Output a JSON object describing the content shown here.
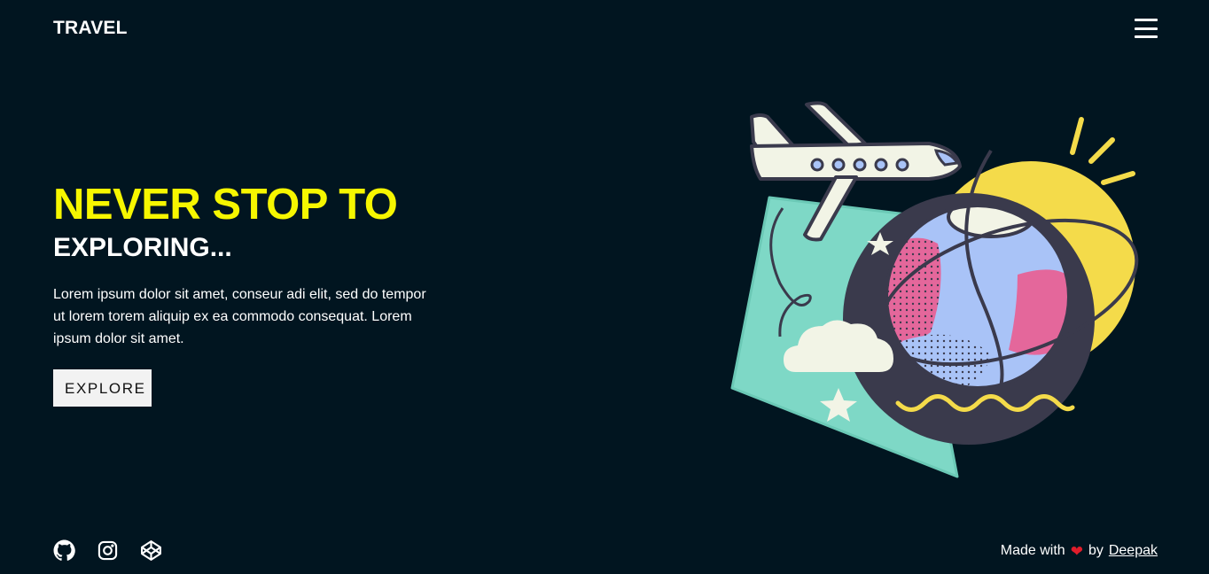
{
  "header": {
    "logo": "TRAVEL",
    "menu_icon": "hamburger-menu-icon"
  },
  "hero": {
    "title": "NEVER STOP TO",
    "subtitle": "EXPLORING...",
    "text": "Lorem ipsum dolor sit amet, conseur adi elit, sed do tempor ut lorem torem aliquip ex ea commodo consequat. Lorem ipsum dolor sit amet.",
    "button_label": "EXPLORE"
  },
  "illustration": {
    "icon": "travel-airplane-globe-illustration"
  },
  "footer": {
    "social": [
      "github-icon",
      "instagram-icon",
      "codepen-icon"
    ],
    "credit_prefix": "Made with",
    "credit_heart": "❤",
    "credit_mid": "by",
    "author": "Deepak"
  },
  "colors": {
    "background": "#011520",
    "accent": "#f6f600",
    "heart": "#e01d2b",
    "button_bg": "#f2f2f2"
  }
}
